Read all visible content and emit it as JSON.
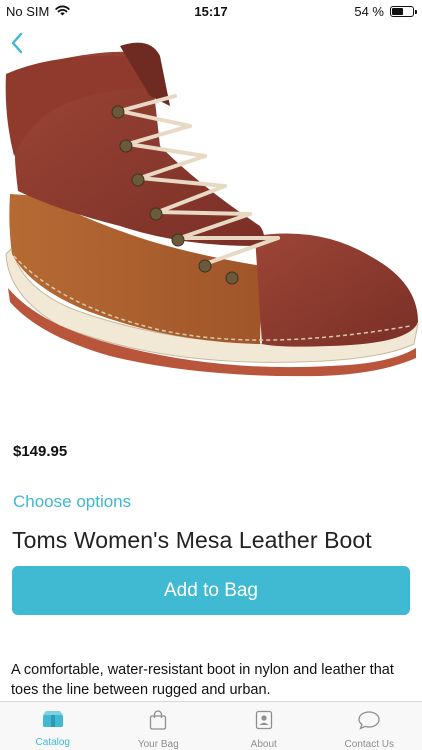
{
  "status_bar": {
    "carrier": "No SIM",
    "time": "15:17",
    "battery_percent": "54 %",
    "battery_level": 0.54
  },
  "product": {
    "price": "$149.95",
    "choose_options_label": "Choose options",
    "title": "Toms Women's Mesa Leather Boot",
    "add_to_bag_label": "Add to Bag",
    "description": "A comfortable, water-resistant boot in nylon and leather that toes the line between rugged and urban."
  },
  "tab_bar": {
    "tabs": [
      {
        "label": "Catalog",
        "icon": "catalog-icon",
        "active": true
      },
      {
        "label": "Your Bag",
        "icon": "bag-icon",
        "active": false
      },
      {
        "label": "About",
        "icon": "about-icon",
        "active": false
      },
      {
        "label": "Contact Us",
        "icon": "chat-bubble-icon",
        "active": false
      }
    ]
  },
  "colors": {
    "accent": "#40bad3",
    "link": "#3fb8cf",
    "boot_leather": "#8b3a2e",
    "boot_tan": "#b0612c"
  }
}
